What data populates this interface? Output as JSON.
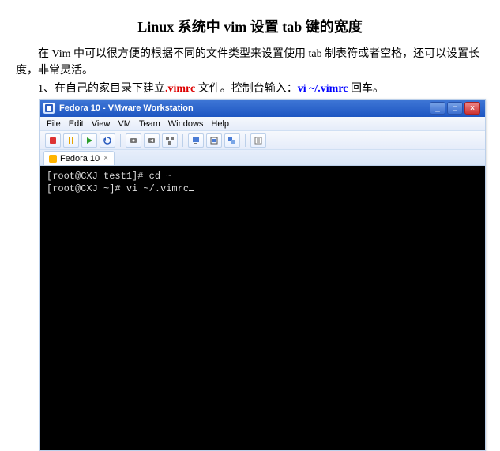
{
  "doc": {
    "title": "Linux 系统中 vim 设置 tab 键的宽度",
    "p1_a": "在 Vim 中可以很方便的根据不同的文件类型来设置使用 tab 制表符或者空格，还可以设置长度，非常灵活。",
    "p2_a": "1、在自己的家目录下建立",
    "p2_red": ".vimrc",
    "p2_b": " 文件。控制台输入：",
    "p2_cmd": "vi ~/.vimrc",
    "p2_c": " 回车。"
  },
  "vmware": {
    "title": "Fedora 10 - VMware Workstation",
    "menu": [
      "File",
      "Edit",
      "View",
      "VM",
      "Team",
      "Windows",
      "Help"
    ],
    "tab_label": "Fedora 10",
    "tab_close": "×"
  },
  "winbtn": {
    "min": "_",
    "max": "□",
    "close": "×"
  },
  "terminal": {
    "line1": "[root@CXJ test1]# cd ~",
    "line2": "[root@CXJ ~]# vi ~/.vimrc"
  }
}
